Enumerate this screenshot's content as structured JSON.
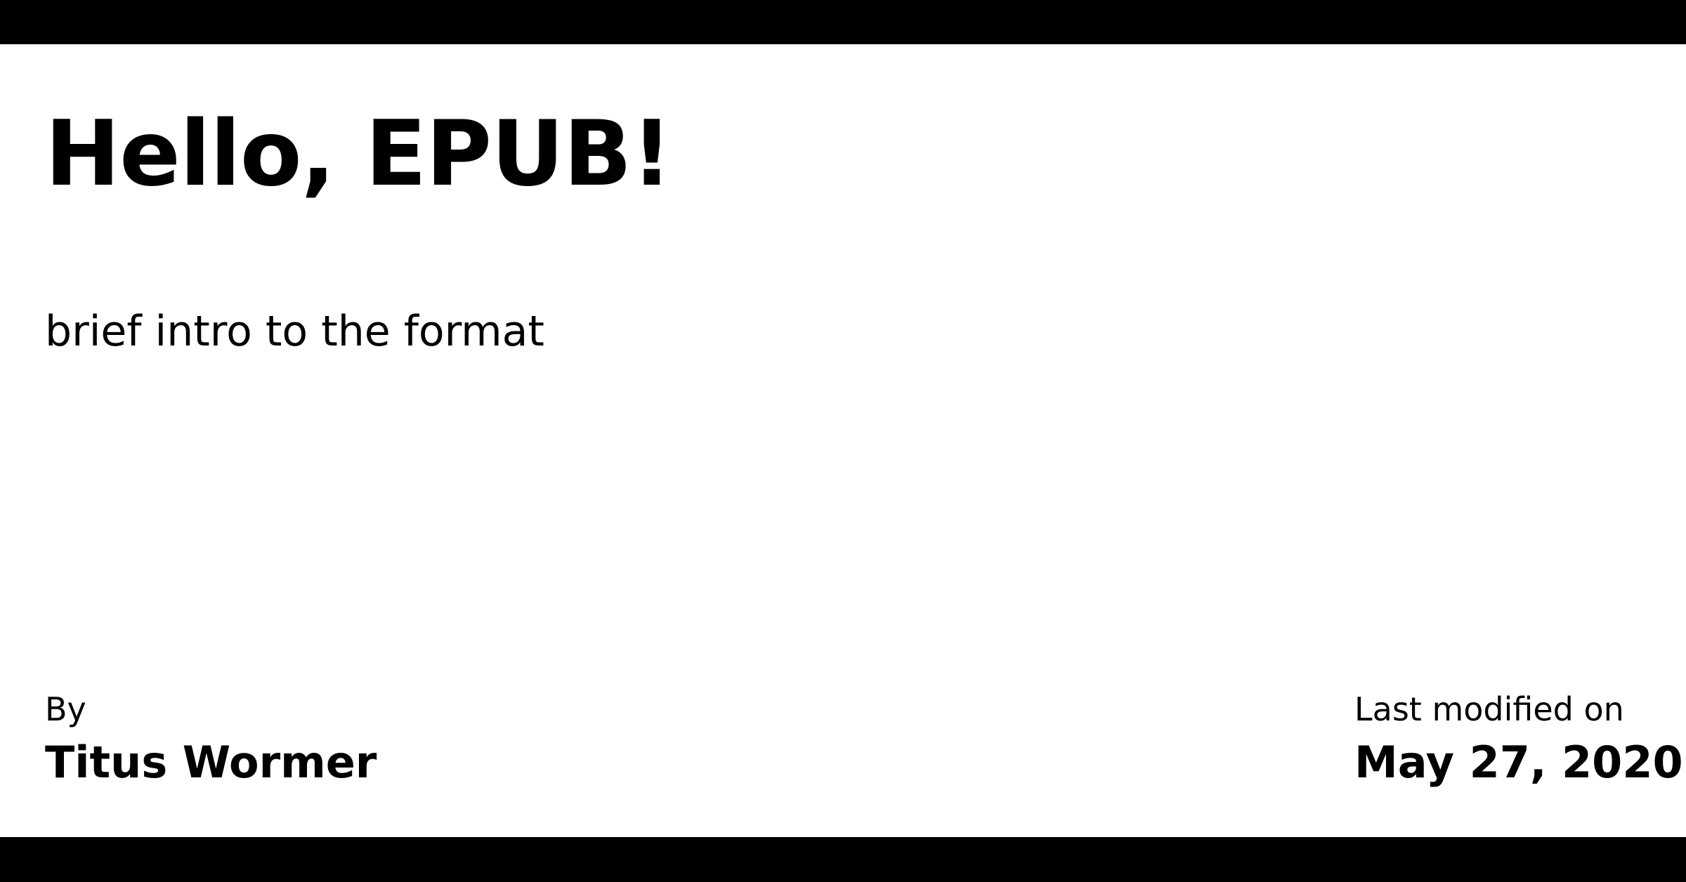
{
  "title": "Hello, EPUB!",
  "description": "brief intro to the format",
  "author": {
    "label": "By",
    "name": "Titus Wormer"
  },
  "modified": {
    "label": "Last modified on",
    "date": "May 27, 2020"
  },
  "colors": {
    "background": "#ffffff",
    "bars": "#000000",
    "text": "#000000"
  }
}
